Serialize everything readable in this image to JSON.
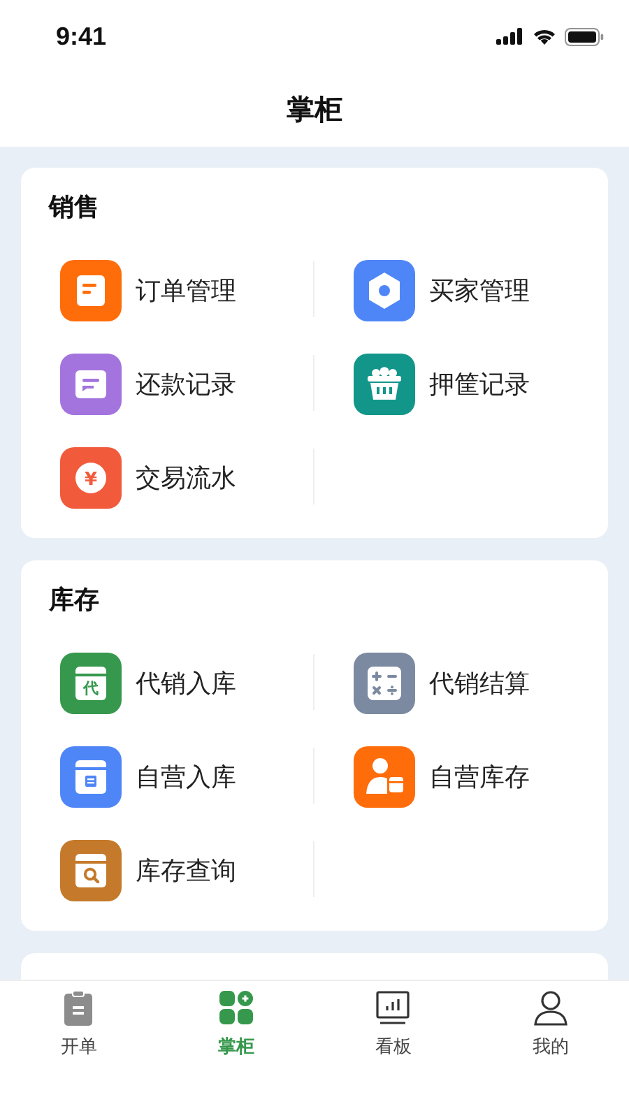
{
  "status_bar": {
    "time": "9:41"
  },
  "header": {
    "title": "掌柜"
  },
  "sections": [
    {
      "title": "销售",
      "items": [
        {
          "label": "订单管理",
          "kind": "doc",
          "color": "#ff6d0a"
        },
        {
          "label": "买家管理",
          "kind": "hexagon",
          "color": "#4f86f7"
        },
        {
          "label": "还款记录",
          "kind": "message",
          "color": "#a374de"
        },
        {
          "label": "押筐记录",
          "kind": "basket",
          "color": "#12968a"
        },
        {
          "label": "交易流水",
          "kind": "coin",
          "color": "#f25a3c",
          "glyph": "¥"
        }
      ]
    },
    {
      "title": "库存",
      "items": [
        {
          "label": "代销入库",
          "kind": "boxglyph",
          "color": "#36984c",
          "glyph": "代"
        },
        {
          "label": "代销结算",
          "kind": "calculator",
          "color": "#7b8aa0"
        },
        {
          "label": "自营入库",
          "kind": "boxdoc",
          "color": "#4f86f7"
        },
        {
          "label": "自营库存",
          "kind": "personbox",
          "color": "#ff6d0a"
        },
        {
          "label": "库存查询",
          "kind": "boxsearch",
          "color": "#c47a2a"
        }
      ]
    }
  ],
  "tabs": [
    {
      "label": "开单",
      "kind": "clipboard",
      "selected": false
    },
    {
      "label": "掌柜",
      "kind": "grid",
      "selected": true
    },
    {
      "label": "看板",
      "kind": "chart",
      "selected": false
    },
    {
      "label": "我的",
      "kind": "person",
      "selected": false
    }
  ]
}
